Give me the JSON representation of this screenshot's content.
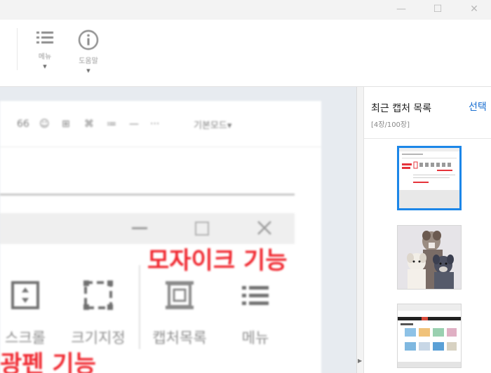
{
  "window": {
    "minimize_glyph": "—",
    "maximize_glyph": "☐",
    "close_glyph": "✕"
  },
  "toolbar": {
    "menu_label": "메뉴",
    "help_label": "도움말"
  },
  "editor": {
    "toolbar_items": [
      "66",
      "☺",
      "⊞",
      "⌘",
      "≔",
      "—",
      "···"
    ],
    "font_select": "기본모드▾"
  },
  "inner_app": {
    "buttons": [
      {
        "label": "스크롤"
      },
      {
        "label": "크기지정"
      },
      {
        "label": "캡처목록"
      },
      {
        "label": "메뉴"
      }
    ]
  },
  "annotations": {
    "mosaic": "모자이크 기능",
    "highlighter": "광펜 기능"
  },
  "panel": {
    "title": "최근 캡처 목록",
    "count": "[4장/100장]",
    "select": "선택"
  },
  "colors": {
    "accent": "#1c86e8",
    "annotation_red": "#f0262e",
    "link_blue": "#1a6fd1"
  }
}
